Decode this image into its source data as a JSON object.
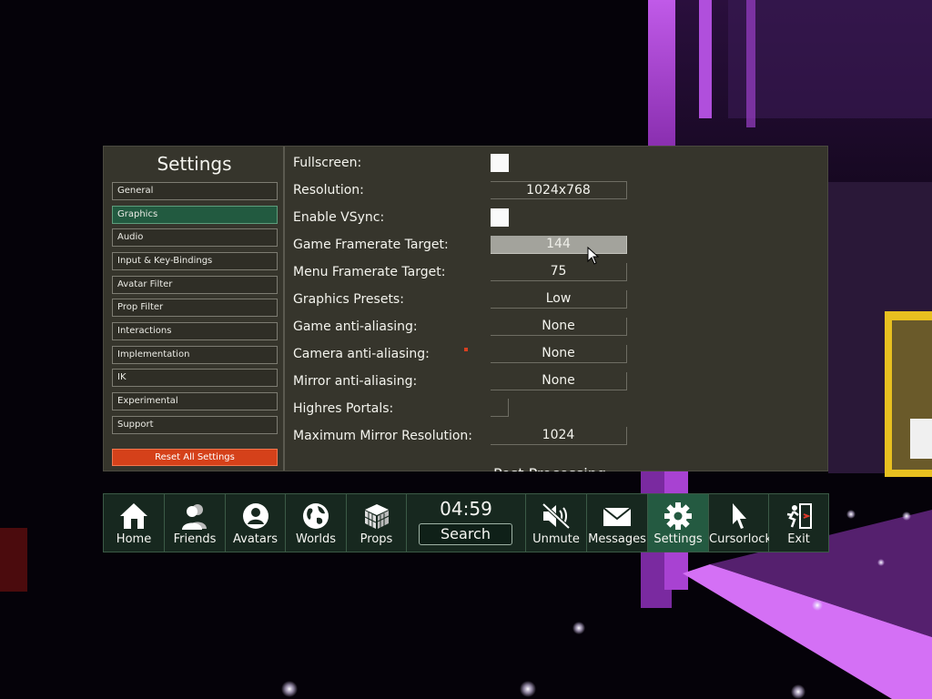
{
  "settings": {
    "title": "Settings",
    "categories": [
      {
        "label": "General"
      },
      {
        "label": "Graphics",
        "active": true
      },
      {
        "label": "Audio"
      },
      {
        "label": "Input & Key-Bindings"
      },
      {
        "label": "Avatar Filter"
      },
      {
        "label": "Prop Filter"
      },
      {
        "label": "Interactions"
      },
      {
        "label": "Implementation"
      },
      {
        "label": "IK"
      },
      {
        "label": "Experimental"
      },
      {
        "label": "Support"
      }
    ],
    "reset_label": "Reset All Settings",
    "options": {
      "fullscreen": {
        "label": "Fullscreen:",
        "checked": true
      },
      "resolution": {
        "label": "Resolution:",
        "value": "1024x768"
      },
      "vsync": {
        "label": "Enable VSync:",
        "checked": true
      },
      "game_fps": {
        "label": "Game Framerate Target:",
        "value": "144"
      },
      "menu_fps": {
        "label": "Menu Framerate Target:",
        "value": "75"
      },
      "presets": {
        "label": "Graphics Presets:",
        "value": "Low"
      },
      "game_aa": {
        "label": "Game anti-aliasing:",
        "value": "None"
      },
      "camera_aa": {
        "label": "Camera anti-aliasing:",
        "value": "None"
      },
      "mirror_aa": {
        "label": "Mirror anti-aliasing:",
        "value": "None"
      },
      "highres": {
        "label": "Highres Portals:",
        "checked": false
      },
      "mirror_res": {
        "label": "Maximum Mirror Resolution:",
        "value": "1024"
      }
    },
    "next_section_heading": "Post Processing"
  },
  "menu": {
    "clock": "04:59",
    "search_label": "Search",
    "items": [
      {
        "label": "Home",
        "icon": "home-icon"
      },
      {
        "label": "Friends",
        "icon": "friends-icon"
      },
      {
        "label": "Avatars",
        "icon": "avatar-icon"
      },
      {
        "label": "Worlds",
        "icon": "globe-icon"
      },
      {
        "label": "Props",
        "icon": "cube-icon"
      },
      {
        "label": "Unmute",
        "icon": "speaker-muted-icon"
      },
      {
        "label": "Messages",
        "icon": "envelope-icon"
      },
      {
        "label": "Settings",
        "icon": "gear-icon",
        "active": true
      },
      {
        "label": "Cursorlock",
        "icon": "cursor-icon"
      },
      {
        "label": "Exit",
        "icon": "exit-icon"
      }
    ]
  },
  "colors": {
    "panel_bg": "#36352c",
    "active_category": "#225a40",
    "reset_button": "#d5411a",
    "menu_bg": "#17281f",
    "menu_active": "#245a41",
    "scene_neon": "#c04fe6"
  }
}
